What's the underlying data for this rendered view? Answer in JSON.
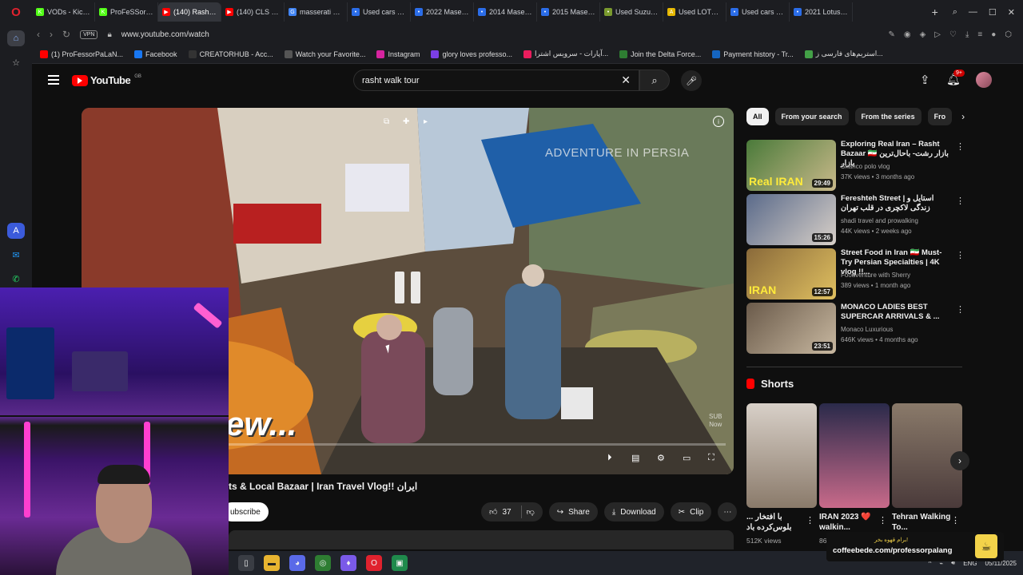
{
  "browser": {
    "tabs": [
      {
        "label": "VODs - Kick Dash",
        "color": "#53fc18",
        "glyph": "K"
      },
      {
        "label": "ProFeSSorPaLaN",
        "color": "#53fc18",
        "glyph": "K"
      },
      {
        "label": "(140) Rasht Walking T",
        "color": "#ff0000",
        "glyph": "▶",
        "active": true
      },
      {
        "label": "(140) CLS BANA",
        "color": "#ff0000",
        "glyph": "▶"
      },
      {
        "label": "masserati 2015 -",
        "color": "#4285f4",
        "glyph": "G"
      },
      {
        "label": "Used cars for sal",
        "color": "#2b6de8",
        "glyph": "•"
      },
      {
        "label": "2022 Maserati M",
        "color": "#2b6de8",
        "glyph": "•"
      },
      {
        "label": "2014 Maserati G",
        "color": "#2b6de8",
        "glyph": "•"
      },
      {
        "label": "2015 Maserati G",
        "color": "#2b6de8",
        "glyph": "•"
      },
      {
        "label": "Used Suzuki Cars",
        "color": "#7a9a2e",
        "glyph": "•"
      },
      {
        "label": "Used LOTUS ELIS",
        "color": "#e6b800",
        "glyph": "A"
      },
      {
        "label": "Used cars for sal",
        "color": "#2b6de8",
        "glyph": "•"
      },
      {
        "label": "2021 Lotus Elise",
        "color": "#2b6de8",
        "glyph": "•"
      }
    ],
    "url": "www.youtube.com/watch",
    "vpn": "VPN",
    "bookmarks": [
      {
        "label": "(1) ProFessorPaLaN...",
        "color": "#ff0000"
      },
      {
        "label": "Facebook",
        "color": "#1877f2"
      },
      {
        "label": "CREATORHUB - Acc...",
        "color": "#333"
      },
      {
        "label": "Watch your Favorite...",
        "color": "#555"
      },
      {
        "label": "Instagram",
        "color": "#d6249f"
      },
      {
        "label": "glory loves professo...",
        "color": "#7b3fe4"
      },
      {
        "label": "آپارات - سرویس اشترا...",
        "color": "#ea1d5d"
      },
      {
        "label": "Join the Delta Force...",
        "color": "#2e7d32"
      },
      {
        "label": "Payment history - Tr...",
        "color": "#1565c0"
      },
      {
        "label": "استریم‌های فارسی ز...",
        "color": "#43a047"
      }
    ]
  },
  "youtube": {
    "logo": "YouTube",
    "region": "GB",
    "search_query": "rasht walk tour",
    "notif_badge": "9+",
    "player": {
      "overlay_title": "ADVENTURE IN PERSIA",
      "big_text": "ew...",
      "watermark": "SUB\nNow",
      "progress": 0.0
    },
    "video_title": "ts & Local Bazaar | Iran Travel Vlog!! ایران",
    "subscribe": "ubscribe",
    "likes": "37",
    "share": "Share",
    "download": "Download",
    "clip": "Clip",
    "chips": [
      "All",
      "From your search",
      "From the series",
      "Fro"
    ],
    "recommendations": [
      {
        "title": "Exploring Real Iran – Rasht Bazaar 🇮🇷 بازار رشت- باحال‌ترین بازار",
        "channel": "Shanco polo vlog",
        "meta": "37K views • 3 months ago",
        "duration": "29:49",
        "thumb_text": "Real IRAN",
        "colors": [
          "#4a7a3a",
          "#c9b98a"
        ]
      },
      {
        "title": "Fereshteh Street | استایل و زندگی لاکچری در قلب تهران",
        "channel": "shadi travel and prowalking",
        "meta": "44K views • 2 weeks ago",
        "duration": "15:26",
        "thumb_text": "",
        "colors": [
          "#5a6a8a",
          "#d8d0c8"
        ]
      },
      {
        "title": "Street Food in Iran 🇮🇷 Must-Try Persian Specialties | 4K vlog !!...",
        "channel": "Foodventure with Sherry",
        "meta": "389 views • 1 month ago",
        "duration": "12:57",
        "thumb_text": "IRAN",
        "colors": [
          "#8a6a3a",
          "#e0c060"
        ]
      },
      {
        "title": "MONACO LADIES BEST SUPERCAR ARRIVALS & ...",
        "channel": "Monaco Luxurious",
        "meta": "646K views • 4 months ago",
        "duration": "23:51",
        "thumb_text": "",
        "colors": [
          "#6a5a4a",
          "#c8b8a0"
        ]
      }
    ],
    "shorts_heading": "Shorts",
    "shorts": [
      {
        "title": "با افتخار ... بلوس‌کرده باد",
        "views": "512K views",
        "colors": [
          "#d8d0c8",
          "#8a7a6a"
        ]
      },
      {
        "title": "IRAN 2023 ❤️ walkin...",
        "views": "86",
        "colors": [
          "#2a2a4a",
          "#c86a8a"
        ]
      },
      {
        "title": "Tehran Walking To...",
        "views": "",
        "colors": [
          "#8a7a6a",
          "#4a3a3a"
        ]
      }
    ]
  },
  "overlay": {
    "coffee_line1": "برام قهوه بخر!",
    "coffee_line2": "coffeebede.com/professorpalang"
  },
  "taskbar": {
    "lang": "ENG",
    "date": "05/11/2025"
  }
}
